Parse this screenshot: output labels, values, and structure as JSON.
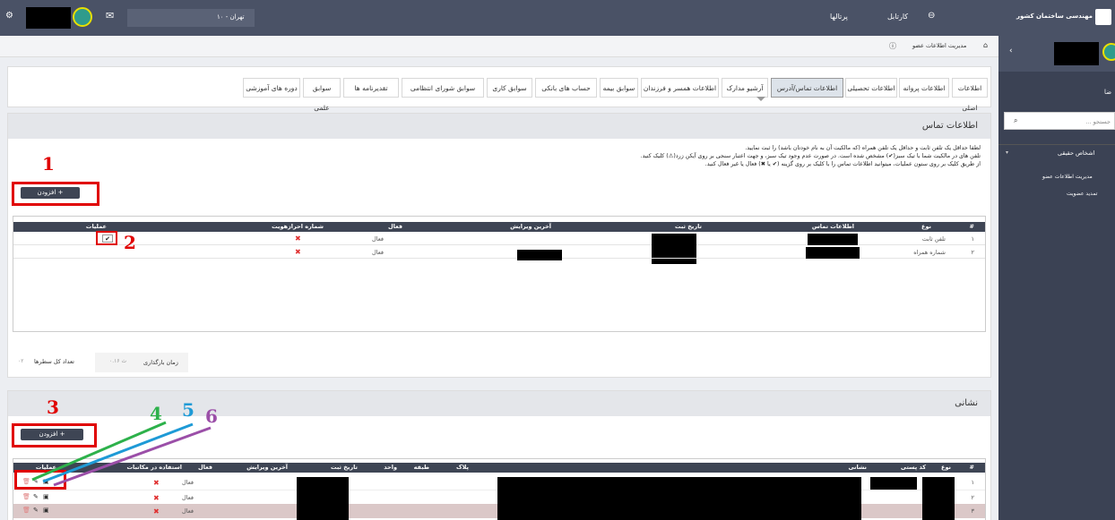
{
  "topbar": {
    "city": "تهران - ۱۰",
    "portals": "پرتالها",
    "cartable": "کارتابل",
    "org": "نظام مهندسی ساختمان کشور"
  },
  "breadcrumb": {
    "item": "مدیریت اطلاعات عضو"
  },
  "sidebar": {
    "search_placeholder": "جستجو ...",
    "partial_label": "ضا",
    "menu": [
      "اشخاص حقیقی",
      "مدیریت اطلاعات عضو",
      "تمدید عضویت"
    ]
  },
  "tabs": [
    "اطلاعات اصلی",
    "اطلاعات پروانه",
    "اطلاعات تحصیلی",
    "اطلاعات تماس/آدرس",
    "آرشیو مدارک",
    "اطلاعات همسر و فرزندان",
    "سوابق بیمه",
    "حساب های بانکی",
    "سوابق کاری",
    "سوابق شورای انتظامی",
    "تقدیرنامه ها",
    "سوابق علمی",
    "دوره های آموزشی"
  ],
  "contact": {
    "title": "اطلاعات تماس",
    "note1": "لطفا حداقل یک تلفن ثابت و حداقل یک تلفن همراه (که مالکیت آن به نام خودتان باشد) را ثبت نمایید.",
    "note2": "تلفن های در مالکیت شما با تیک سبز(✔) مشخص شده است. در صورت عدم وجود تیک سبز، و جهت اعتبار سنجی بر روی آیکن زرد(⚠) کلیک کنید.",
    "note3": "از طریق کلیک بر روی ستون عملیات، میتوانید اطلاعات تماس را با کلیک بر روی گزینه (✔ یا ✖) فعال یا غیر فعال کنید.",
    "add_label": "افزودن +",
    "headers": [
      "#",
      "نوع",
      "اطلاعات تماس",
      "تاریخ ثبت",
      "آخرین ویرایش",
      "فعال",
      "شماره احرازهویت",
      "عملیات"
    ],
    "rows": [
      {
        "n": "۱",
        "type": "تلفن ثابت",
        "status": "فعال"
      },
      {
        "n": "۲",
        "type": "شماره همراه",
        "status": "فعال"
      }
    ],
    "load_time_label": "زمان بارگذاری",
    "load_time_value": "۰.۱۶ ث",
    "total_rows_label": "تعداد کل سطرها",
    "total_rows_value": "۰۲"
  },
  "address": {
    "title": "نشانی",
    "add_label": "افزودن +",
    "headers": [
      "#",
      "نوع",
      "کد پستی",
      "نشانی",
      "پلاک",
      "طبقه",
      "واحد",
      "تاریخ ثبت",
      "آخرین ویرایش",
      "فعال",
      "استفاده در مکاتبات",
      "عملیات"
    ],
    "rows": [
      {
        "n": "۱",
        "status": "فعال"
      },
      {
        "n": "۲",
        "status": "فعال"
      },
      {
        "n": "۳",
        "status": "فعال"
      }
    ]
  },
  "annotations": {
    "n1": "1",
    "n2": "2",
    "n3": "3",
    "n4": "4",
    "n5": "5",
    "n6": "6"
  },
  "colors": {
    "red": "#e00000",
    "green": "#2db14b",
    "blue": "#1e9ad6",
    "purple": "#9b4fa8"
  }
}
